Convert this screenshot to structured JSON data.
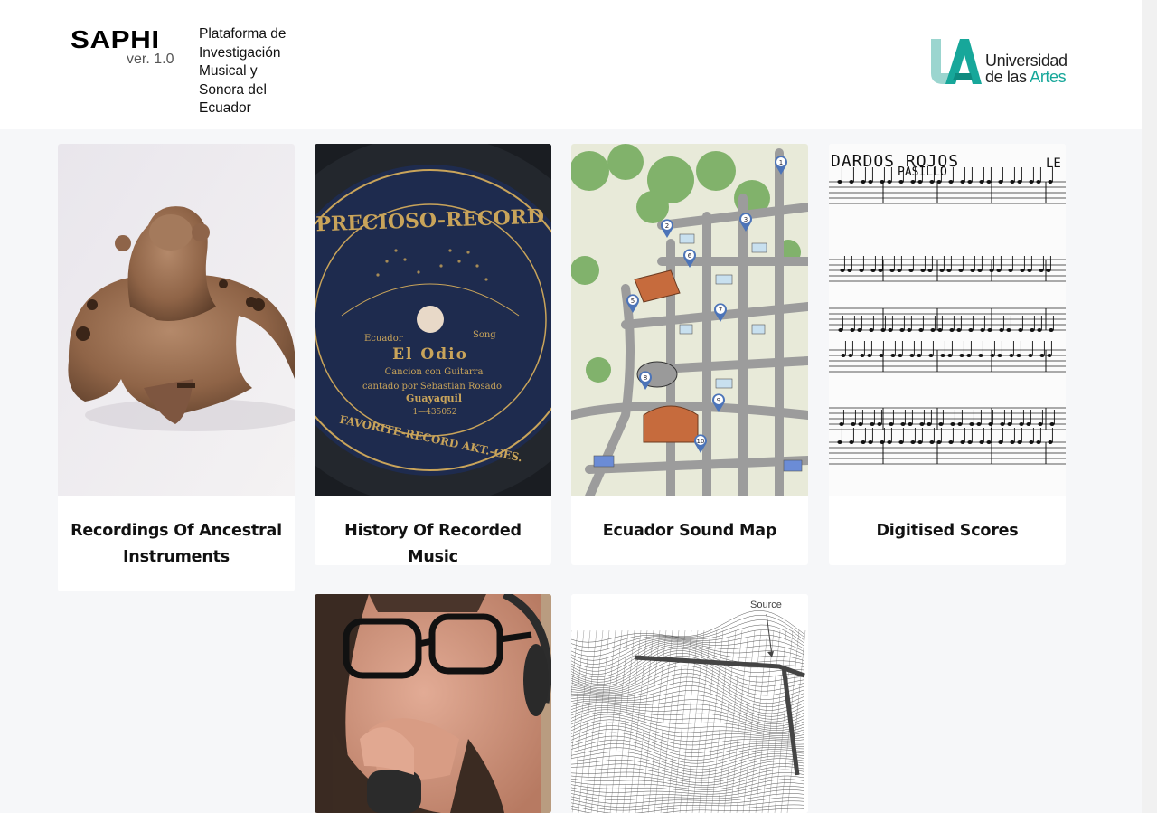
{
  "header": {
    "logo": {
      "name": "SAPHI",
      "version": "ver. 1.0",
      "description": "Plataforma de\nInvestigación\nMusical y\nSonora del\nEcuador"
    },
    "university_logo": {
      "line1": "Universidad",
      "line2_prefix": "de las ",
      "line2_accent": "Artes",
      "accent_color": "#17a79a"
    }
  },
  "cards": [
    {
      "title": "Recordings Of Ancestral Instruments",
      "image": "ceramic-ocarina-photo"
    },
    {
      "title": "History Of Recorded Music",
      "image": "gramophone-record-photo"
    },
    {
      "title": "Ecuador Sound Map",
      "image": "illustrated-map"
    },
    {
      "title": "Digitised Scores",
      "image": "handwritten-score"
    },
    {
      "title": "",
      "image": "singer-with-headphones-photo"
    },
    {
      "title": "",
      "image": "wireframe-terrain-render"
    }
  ],
  "images": {
    "record": {
      "label_top": "PRECIOSO-RECORD",
      "country": "Ecuador",
      "genre": "Song",
      "song": "El Odio",
      "line1": "Cancion con Guitarra",
      "line2": "cantado por Sebastian Rosado",
      "city": "Guayaquil",
      "catalog": "1—435052",
      "label_bottom": "FAVORITE-RECORD AKT.-GES."
    },
    "score": {
      "title": "DARDOS ROJOS",
      "subtitle": "PASILLO"
    },
    "terrain": {
      "annotation": "Source"
    },
    "map_markers": [
      "1",
      "2",
      "3",
      "5",
      "6",
      "7",
      "8",
      "9",
      "10"
    ]
  }
}
